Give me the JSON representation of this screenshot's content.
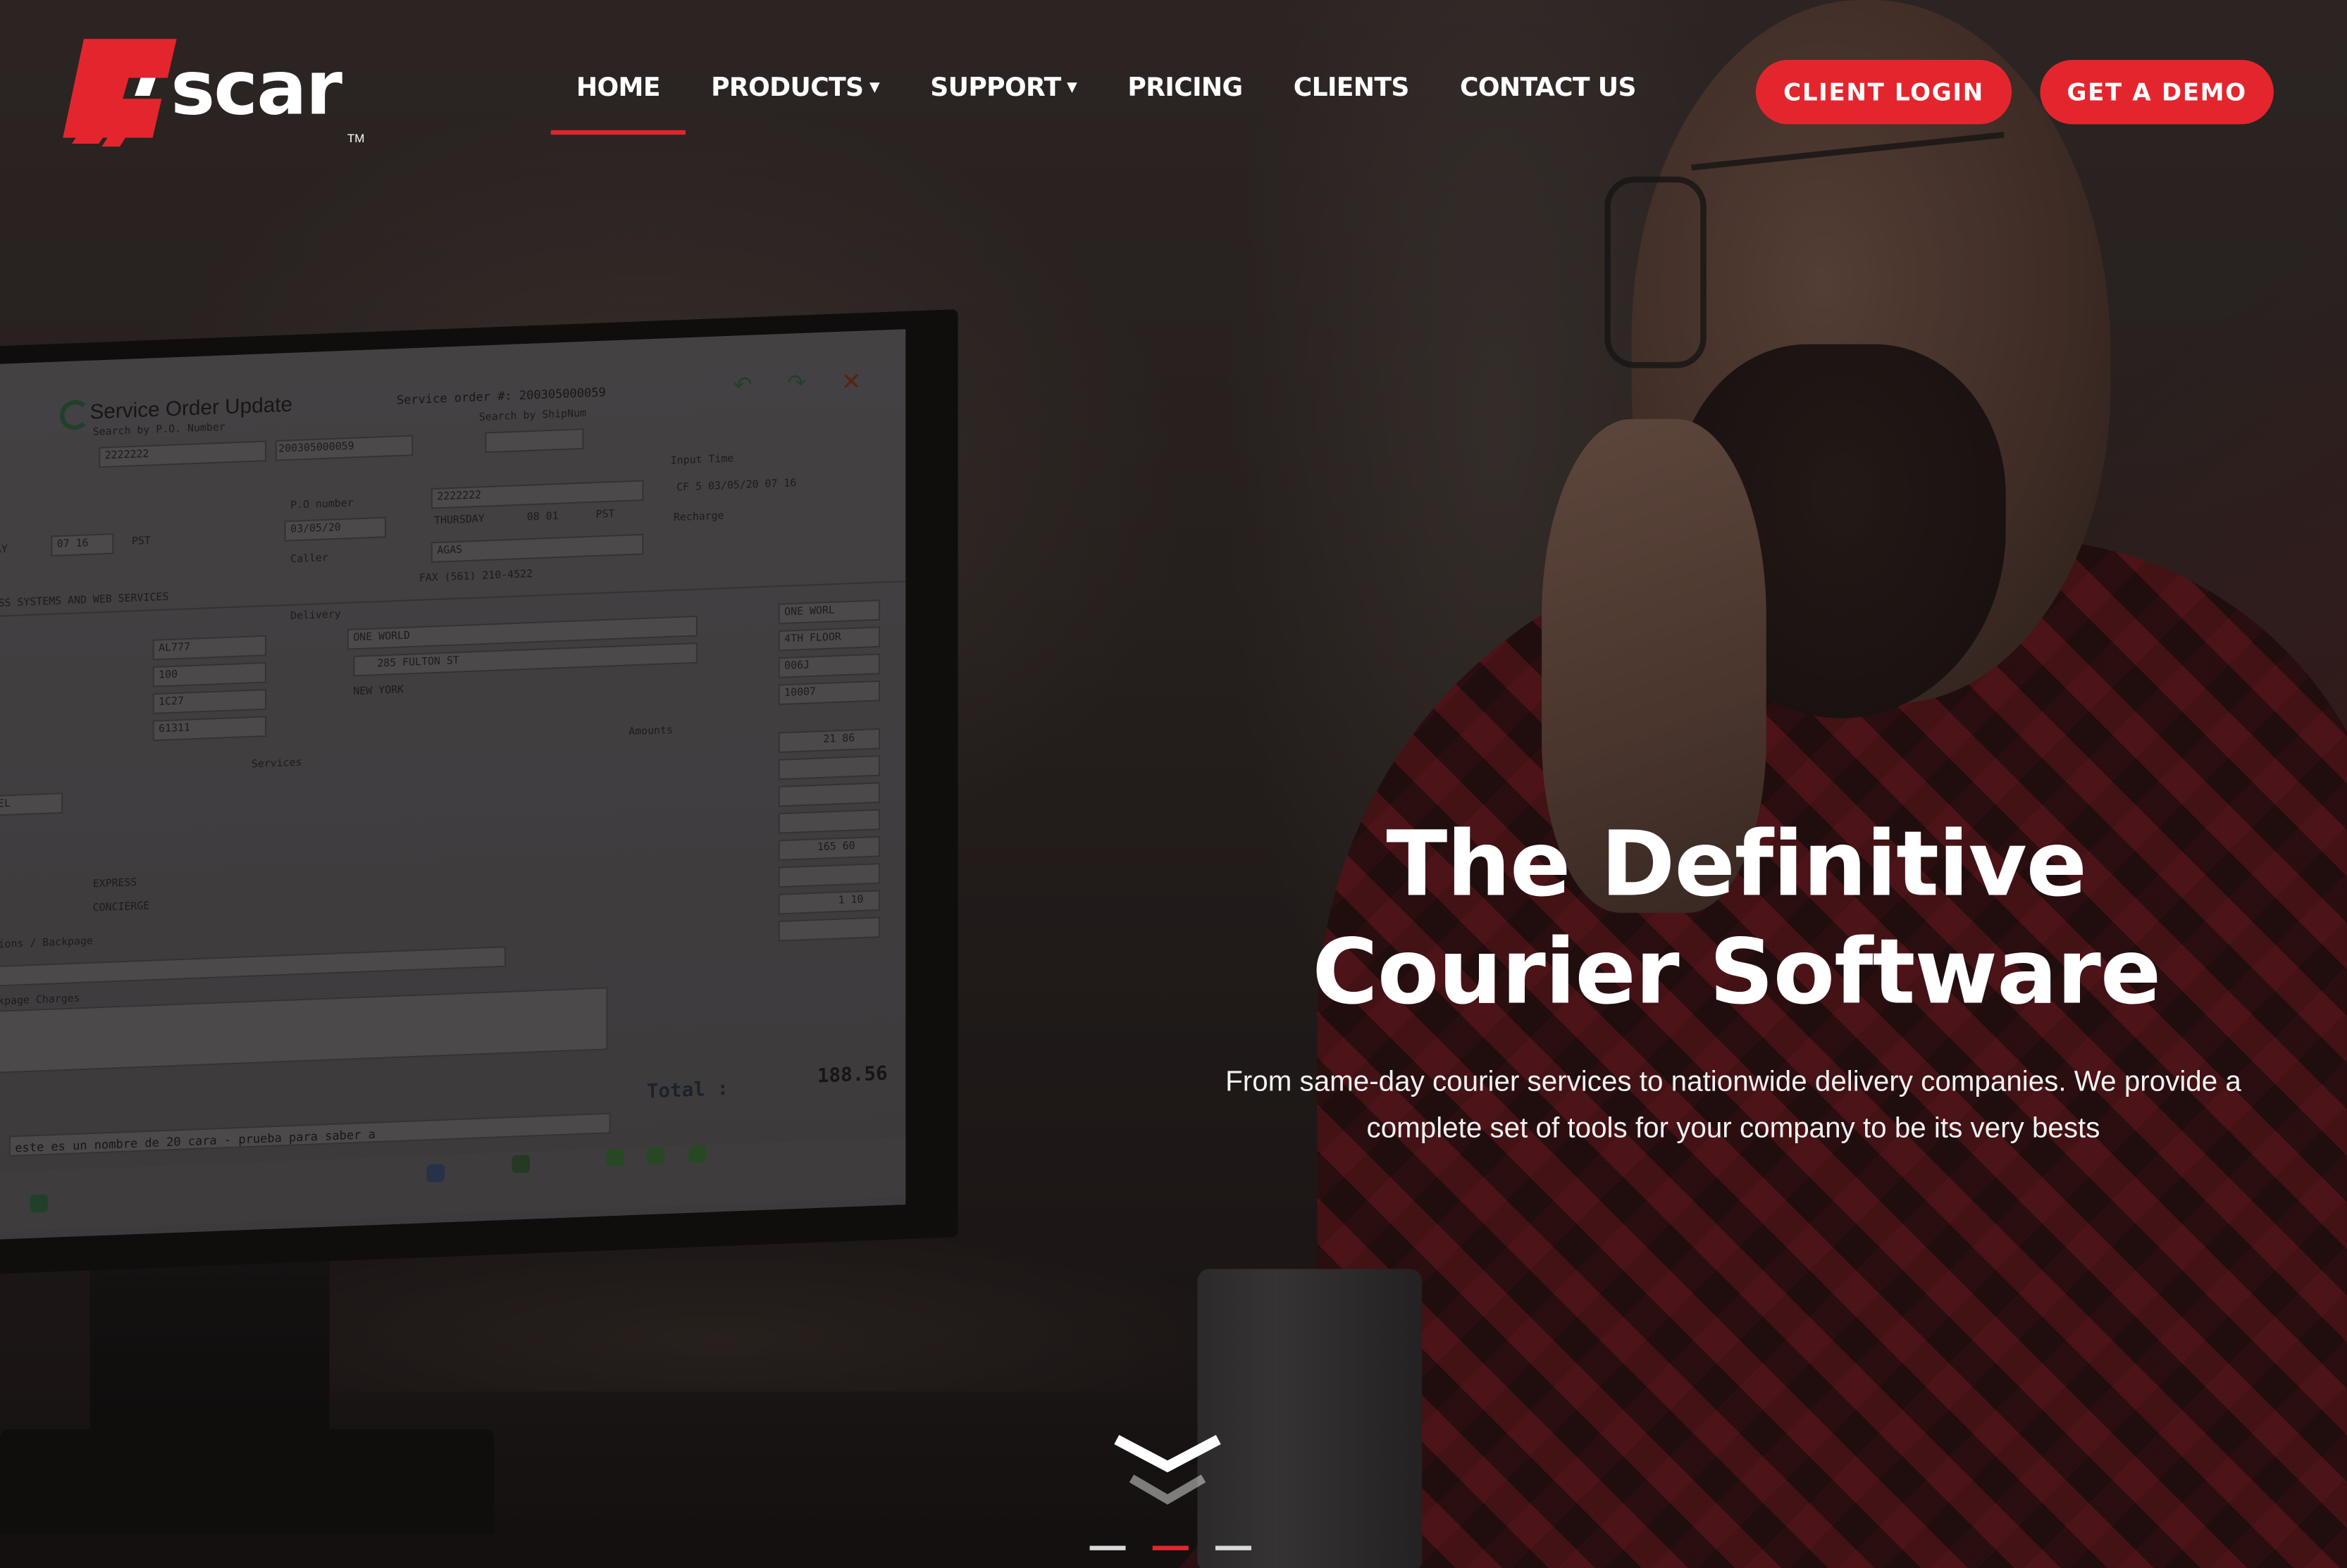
{
  "brand": {
    "name": "scar",
    "trademark": "TM",
    "accent_color": "#e3262e"
  },
  "nav": {
    "items": [
      {
        "label": "HOME",
        "active": true,
        "dropdown": false
      },
      {
        "label": "PRODUCTS",
        "active": false,
        "dropdown": true
      },
      {
        "label": "SUPPORT",
        "active": false,
        "dropdown": true
      },
      {
        "label": "PRICING",
        "active": false,
        "dropdown": false
      },
      {
        "label": "CLIENTS",
        "active": false,
        "dropdown": false
      },
      {
        "label": "CONTACT US",
        "active": false,
        "dropdown": false
      }
    ]
  },
  "actions": {
    "client_login": "CLIENT LOGIN",
    "get_demo": "GET A DEMO"
  },
  "hero": {
    "title_line1": "The Definitive",
    "title_line2": "Courier Software",
    "subtitle": "From same-day courier services to nationwide delivery companies. We provide a complete set of tools for your company to be its very bests"
  },
  "monitor_screen": {
    "window_title": "Service Order Update",
    "service_order_label": "Service order #: 200305000059",
    "search_po": "Search by P.O. Number",
    "search_shipnum": "Search by ShipNum",
    "po_value": "2222222",
    "order_value": "200305000059",
    "po_number_label": "P.O number",
    "po_number_value": "2222222",
    "date_value": "03/05/20",
    "day_value": "THURSDAY",
    "time_value": "08 01",
    "tz_value": "PST",
    "day_left": "RSDAY",
    "time_left": "07 16",
    "tz_left": "PST",
    "caller_label": "Caller",
    "caller_value": "AGAS",
    "company_line": "SINESS SYSTEMS AND WEB SERVICES",
    "fax_line": "FAX (561) 210-4522",
    "input_time_label": "Input Time",
    "input_time_value": "CF 5 03/05/20 07 16",
    "recharge_label": "Recharge",
    "delivery_label": "Delivery",
    "pickup_code": "AL777",
    "pickup_room": "100",
    "pickup_zone": "1C27",
    "pickup_zip": "61311",
    "delivery_name": "ONE WORLD",
    "delivery_address": "285 FULTON ST",
    "delivery_city": "NEW YORK",
    "delivery_code": "ONE WORL",
    "delivery_room": "4TH FLOOR",
    "delivery_zone": "006J",
    "delivery_zip": "10007",
    "vehicle_type": "DEVEL",
    "services_label": "Services",
    "amounts_label": "Amounts",
    "express_label": "EXPRESS",
    "concierge_label": "CONCIERGE",
    "backpage_label": "Backpage Charges",
    "instructions_label": "ructions / Backpage",
    "amount_base": "21 86",
    "amount_wait": "165 60",
    "amount_fuel": "1 10",
    "total_label": "Total :",
    "total_value": "188.56",
    "comment": "este es un nombre de 20 cara - prueba para saber a"
  },
  "scroll": {
    "icon": "chevron-down-icon"
  },
  "slider": {
    "dot_count": 3,
    "active_index": 1
  }
}
